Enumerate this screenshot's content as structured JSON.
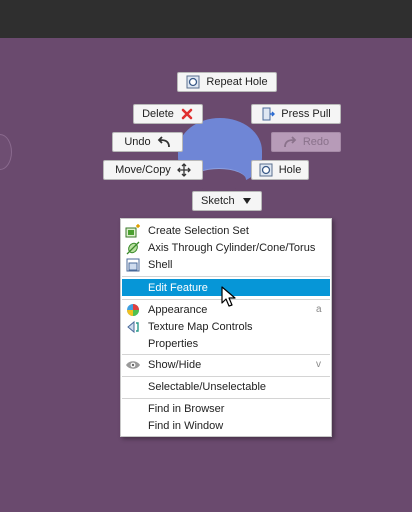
{
  "marking_menu": {
    "repeat_hole": "Repeat Hole",
    "delete": "Delete",
    "press_pull": "Press Pull",
    "undo": "Undo",
    "redo": "Redo",
    "move_copy": "Move/Copy",
    "hole": "Hole",
    "sketch": "Sketch"
  },
  "context_menu": {
    "create_selection_set": "Create Selection Set",
    "axis_through": "Axis Through Cylinder/Cone/Torus",
    "shell": "Shell",
    "edit_feature": "Edit Feature",
    "appearance": "Appearance",
    "appearance_shortcut": "a",
    "texture_map_controls": "Texture Map Controls",
    "properties": "Properties",
    "show_hide": "Show/Hide",
    "show_hide_shortcut": "v",
    "selectable_unselectable": "Selectable/Unselectable",
    "find_in_browser": "Find in Browser",
    "find_in_window": "Find in Window"
  },
  "colors": {
    "canvas": "#6a4a6e",
    "highlight": "#0696d7",
    "delete_x": "#e03030"
  }
}
